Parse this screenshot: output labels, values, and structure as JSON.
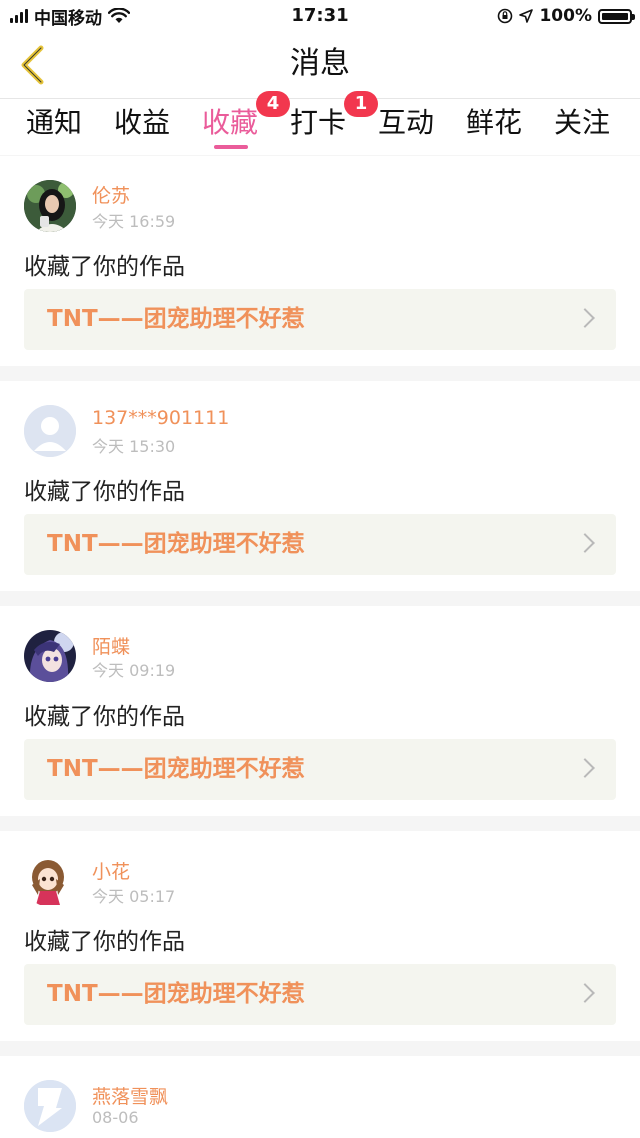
{
  "status_bar": {
    "carrier": "中国移动",
    "time": "17:31",
    "battery": "100%",
    "icons": [
      "signal-icon",
      "wifi-icon",
      "orientation-lock-icon",
      "location-icon",
      "battery-icon"
    ]
  },
  "nav": {
    "title": "消息",
    "back_icon": "chevron-left-icon"
  },
  "tabs": [
    {
      "label": "通知",
      "active": false,
      "badge": ""
    },
    {
      "label": "收益",
      "active": false,
      "badge": ""
    },
    {
      "label": "收藏",
      "active": true,
      "badge": "4"
    },
    {
      "label": "打卡",
      "active": false,
      "badge": "1"
    },
    {
      "label": "互动",
      "active": false,
      "badge": ""
    },
    {
      "label": "鲜花",
      "active": false,
      "badge": ""
    },
    {
      "label": "关注",
      "active": false,
      "badge": ""
    }
  ],
  "messages": [
    {
      "user": "伦苏",
      "time": "今天 16:59",
      "action": "收藏了你的作品",
      "work": "TNT——团宠助理不好惹"
    },
    {
      "user": "137***901111",
      "time": "今天 15:30",
      "action": "收藏了你的作品",
      "work": "TNT——团宠助理不好惹"
    },
    {
      "user": "陌蝶",
      "time": "今天 09:19",
      "action": "收藏了你的作品",
      "work": "TNT——团宠助理不好惹"
    },
    {
      "user": "小花",
      "time": "今天 05:17",
      "action": "收藏了你的作品",
      "work": "TNT——团宠助理不好惹"
    },
    {
      "user": "燕落雪飘",
      "time": "08-06"
    }
  ],
  "colors": {
    "accent": "#ea5c9a",
    "username": "#f0915a",
    "badge": "#f2374e",
    "back_chevron": "#e6c43a"
  }
}
